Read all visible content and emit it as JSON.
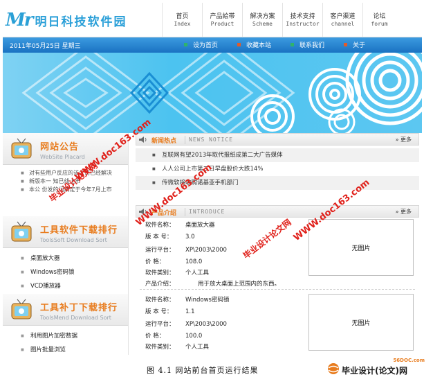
{
  "site": {
    "logo_mark": "Mr",
    "logo_text": "明日科技软件园"
  },
  "nav": [
    {
      "cn": "首页",
      "en": "Index"
    },
    {
      "cn": "产品絵帯",
      "en": "Product"
    },
    {
      "cn": "解决方案",
      "en": "Scheme"
    },
    {
      "cn": "技术支持",
      "en": "Instructor"
    },
    {
      "cn": "客户渠道",
      "en": "channel"
    },
    {
      "cn": "论坛",
      "en": "forum"
    }
  ],
  "datebar": {
    "date": "2011年05月25日  星期三",
    "links": [
      {
        "label": "设为首页",
        "color": "#2fb36b"
      },
      {
        "label": "收藏本站",
        "color": "#e25b2a"
      },
      {
        "label": "联系我们",
        "color": "#2fb36b"
      },
      {
        "label": "关于",
        "color": "#e25b2a"
      }
    ]
  },
  "left": {
    "notice": {
      "title": "网站公告",
      "subtitle": "WebSite Placard",
      "items": [
        "对有些用户反应的该公司已经解决",
        "新版本一  知已线上市",
        "本公  份发的词典定于今年7月上市"
      ]
    },
    "tools": {
      "title": "工具软件下载排行",
      "subtitle": "ToolsSoft Download Sort",
      "items": [
        "桌面放大器",
        "Windows密码锁",
        "VCD播放器"
      ]
    },
    "patches": {
      "title": "工具补丁下载排行",
      "subtitle": "ToolsMend Download Sort",
      "items": [
        "利用图片加密数据",
        "图片批量浏览"
      ]
    }
  },
  "news": {
    "title": "新闻热点",
    "en": "NEWS NOTICE",
    "more": "更多",
    "items": [
      "互联网有望2013年取代报纸成第二大广告媒体",
      "人人公司上市第二日早盘股价大跌14%",
      "传微软将收购诺基亚手机部门"
    ]
  },
  "products": {
    "title": "产品介绍",
    "en": "INTRODUCE",
    "more": "更多",
    "labels": {
      "name": "软件名称：",
      "version": "版 本 号：",
      "platform": "运行平台：",
      "price": "价    格：",
      "category": "软件类别：",
      "intro": "产品介绍："
    },
    "no_image": "无图片",
    "items": [
      {
        "name": "桌面放大器",
        "version": "3.0",
        "platform": "XP\\2003\\2000",
        "price": "108.0",
        "category": "个人工具",
        "intro": "用于放大桌面上范围内的东西。"
      },
      {
        "name": "Windows密码锁",
        "version": "1.1",
        "platform": "XP\\2003\\2000",
        "price": "100.0",
        "category": "个人工具"
      }
    ]
  },
  "watermark": {
    "text_a": "毕业设计论文网",
    "text_b": "WWW.doc163.com"
  },
  "caption": "图 4.1   网站前台首页运行结果",
  "brand": {
    "site": "56DOC.com",
    "name": "毕业设计(论文)网"
  }
}
